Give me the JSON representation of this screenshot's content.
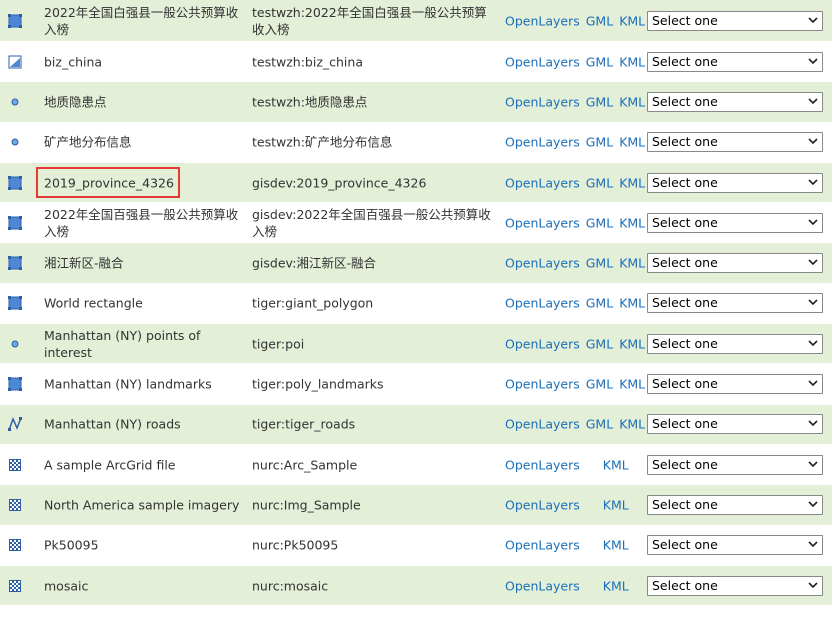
{
  "rows": [
    {
      "icon": "polygon-icon",
      "title": "2022年全国白强县一般公共预算收入榜",
      "name": "testwzh:2022年全国白强县一般公共预算收入榜",
      "links": [
        "OpenLayers",
        "GML",
        "KML"
      ],
      "select": "Select one"
    },
    {
      "icon": "raster-icon",
      "title": "biz_china",
      "name": "testwzh:biz_china",
      "links": [
        "OpenLayers",
        "GML",
        "KML"
      ],
      "select": "Select one"
    },
    {
      "icon": "point-icon",
      "title": "地质隐患点",
      "name": "testwzh:地质隐患点",
      "links": [
        "OpenLayers",
        "GML",
        "KML"
      ],
      "select": "Select one"
    },
    {
      "icon": "point-icon",
      "title": "矿产地分布信息",
      "name": "testwzh:矿产地分布信息",
      "links": [
        "OpenLayers",
        "GML",
        "KML"
      ],
      "select": "Select one"
    },
    {
      "icon": "polygon-icon",
      "title": "2019_province_4326",
      "name": "gisdev:2019_province_4326",
      "links": [
        "OpenLayers",
        "GML",
        "KML"
      ],
      "select": "Select one"
    },
    {
      "icon": "polygon-icon",
      "title": "2022年全国百强县一般公共预算收入榜",
      "name": "gisdev:2022年全国百强县一般公共预算收入榜",
      "links": [
        "OpenLayers",
        "GML",
        "KML"
      ],
      "select": "Select one"
    },
    {
      "icon": "polygon-icon",
      "title": "湘江新区-融合",
      "name": "gisdev:湘江新区-融合",
      "links": [
        "OpenLayers",
        "GML",
        "KML"
      ],
      "select": "Select one"
    },
    {
      "icon": "polygon-icon",
      "title": "World rectangle",
      "name": "tiger:giant_polygon",
      "links": [
        "OpenLayers",
        "GML",
        "KML"
      ],
      "select": "Select one"
    },
    {
      "icon": "point-icon",
      "title": "Manhattan (NY) points of interest",
      "name": "tiger:poi",
      "links": [
        "OpenLayers",
        "GML",
        "KML"
      ],
      "select": "Select one"
    },
    {
      "icon": "polygon-icon",
      "title": "Manhattan (NY) landmarks",
      "name": "tiger:poly_landmarks",
      "links": [
        "OpenLayers",
        "GML",
        "KML"
      ],
      "select": "Select one"
    },
    {
      "icon": "line-icon",
      "title": "Manhattan (NY) roads",
      "name": "tiger:tiger_roads",
      "links": [
        "OpenLayers",
        "GML",
        "KML"
      ],
      "select": "Select one"
    },
    {
      "icon": "grid-icon",
      "title": "A sample ArcGrid file",
      "name": "nurc:Arc_Sample",
      "links": [
        "OpenLayers",
        "KML"
      ],
      "select": "Select one"
    },
    {
      "icon": "grid-icon",
      "title": "North America sample imagery",
      "name": "nurc:Img_Sample",
      "links": [
        "OpenLayers",
        "KML"
      ],
      "select": "Select one"
    },
    {
      "icon": "grid-icon",
      "title": "Pk50095",
      "name": "nurc:Pk50095",
      "links": [
        "OpenLayers",
        "KML"
      ],
      "select": "Select one"
    },
    {
      "icon": "grid-icon",
      "title": "mosaic",
      "name": "nurc:mosaic",
      "links": [
        "OpenLayers",
        "KML"
      ],
      "select": "Select one"
    }
  ],
  "colors": {
    "shade": "#e4efd8",
    "link": "#1b6fb8",
    "highlight": "#e53935"
  }
}
